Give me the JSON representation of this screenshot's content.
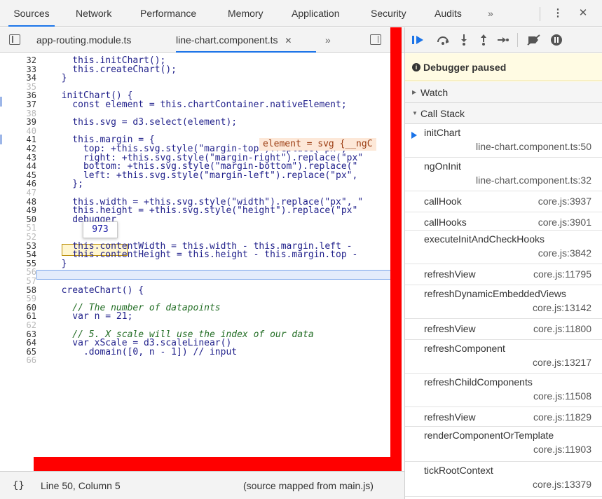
{
  "top_tabs": {
    "sources": "Sources",
    "network": "Network",
    "performance": "Performance",
    "memory": "Memory",
    "application": "Application",
    "security": "Security",
    "audits": "Audits",
    "more": "»",
    "kebab": "⋮",
    "close": "✕"
  },
  "file_tabs": {
    "file1": "app-routing.module.ts",
    "file2": "line-chart.component.ts",
    "file2_close": "✕",
    "more": "»"
  },
  "code_lines": [
    {
      "n": "32",
      "t": "    this.initChart();"
    },
    {
      "n": "33",
      "t": "    this.createChart();"
    },
    {
      "n": "34",
      "t": "  }"
    },
    {
      "n": "35",
      "t": ""
    },
    {
      "n": "36",
      "t": "  initChart() {"
    },
    {
      "n": "37",
      "t": "    const element = this.chartContainer.nativeElement;"
    },
    {
      "n": "38",
      "t": ""
    },
    {
      "n": "39",
      "t": "    this.svg = d3.select(element);"
    },
    {
      "n": "40",
      "t": ""
    },
    {
      "n": "41",
      "t": "    this.margin = {"
    },
    {
      "n": "42",
      "t": "      top: +this.svg.style(\"margin-top\").replace(\"px\", \"\""
    },
    {
      "n": "43",
      "t": "      right: +this.svg.style(\"margin-right\").replace(\"px\""
    },
    {
      "n": "44",
      "t": "      bottom: +this.svg.style(\"margin-bottom\").replace(\""
    },
    {
      "n": "45",
      "t": "      left: +this.svg.style(\"margin-left\").replace(\"px\","
    },
    {
      "n": "46",
      "t": "    };"
    },
    {
      "n": "47",
      "t": ""
    },
    {
      "n": "48",
      "t": "    this.width = +this.svg.style(\"width\").replace(\"px\", \""
    },
    {
      "n": "49",
      "t": "    this.height = +this.svg.style(\"height\").replace(\"px\""
    },
    {
      "n": "50",
      "t": "    debugger"
    },
    {
      "n": "51",
      "t": ""
    },
    {
      "n": "52",
      "t": ""
    },
    {
      "n": "53",
      "t": "    this.contentWidth = this.width - this.margin.left - "
    },
    {
      "n": "54",
      "t": "    this.contentHeight = this.height - this.margin.top -"
    },
    {
      "n": "55",
      "t": "  }"
    },
    {
      "n": "56",
      "t": ""
    },
    {
      "n": "57",
      "t": ""
    },
    {
      "n": "58",
      "t": "  createChart() {"
    },
    {
      "n": "59",
      "t": ""
    },
    {
      "n": "60",
      "t": "    // The number of datapoints"
    },
    {
      "n": "61",
      "t": "    var n = 21;"
    },
    {
      "n": "62",
      "t": ""
    },
    {
      "n": "63",
      "t": "    // 5. X scale will use the index of our data"
    },
    {
      "n": "64",
      "t": "    var xScale = d3.scaleLinear()"
    },
    {
      "n": "65",
      "t": "      .domain([0, n - 1]) // input"
    },
    {
      "n": "66",
      "t": ""
    }
  ],
  "inline_value_39": "element = svg {__ngC",
  "hover_tooltip": "973",
  "status": {
    "braces": "{}",
    "position": "Line 50, Column 5",
    "source_mapped": "(source mapped from main.js)"
  },
  "debugger": {
    "paused_label": "Debugger paused",
    "watch_label": "Watch",
    "callstack_label": "Call Stack"
  },
  "call_stack": [
    {
      "name": "initChart",
      "loc": "line-chart.component.ts:50"
    },
    {
      "name": "ngOnInit",
      "loc": "line-chart.component.ts:32"
    },
    {
      "name": "callHook",
      "loc": "core.js:3937"
    },
    {
      "name": "callHooks",
      "loc": "core.js:3901"
    },
    {
      "name": "executeInitAndCheckHooks",
      "loc": "core.js:3842"
    },
    {
      "name": "refreshView",
      "loc": "core.js:11795"
    },
    {
      "name": "refreshDynamicEmbeddedViews",
      "loc": "core.js:13142"
    },
    {
      "name": "refreshView",
      "loc": "core.js:11800"
    },
    {
      "name": "refreshComponent",
      "loc": "core.js:13217"
    },
    {
      "name": "refreshChildComponents",
      "loc": "core.js:11508"
    },
    {
      "name": "refreshView",
      "loc": "core.js:11829"
    },
    {
      "name": "renderComponentOrTemplate",
      "loc": "core.js:11903"
    },
    {
      "name": "tickRootContext",
      "loc": "core.js:13379"
    }
  ],
  "colors": {
    "accent": "#1a73e8",
    "redline": "#ff0000",
    "paused_bg": "#fffbe3"
  }
}
